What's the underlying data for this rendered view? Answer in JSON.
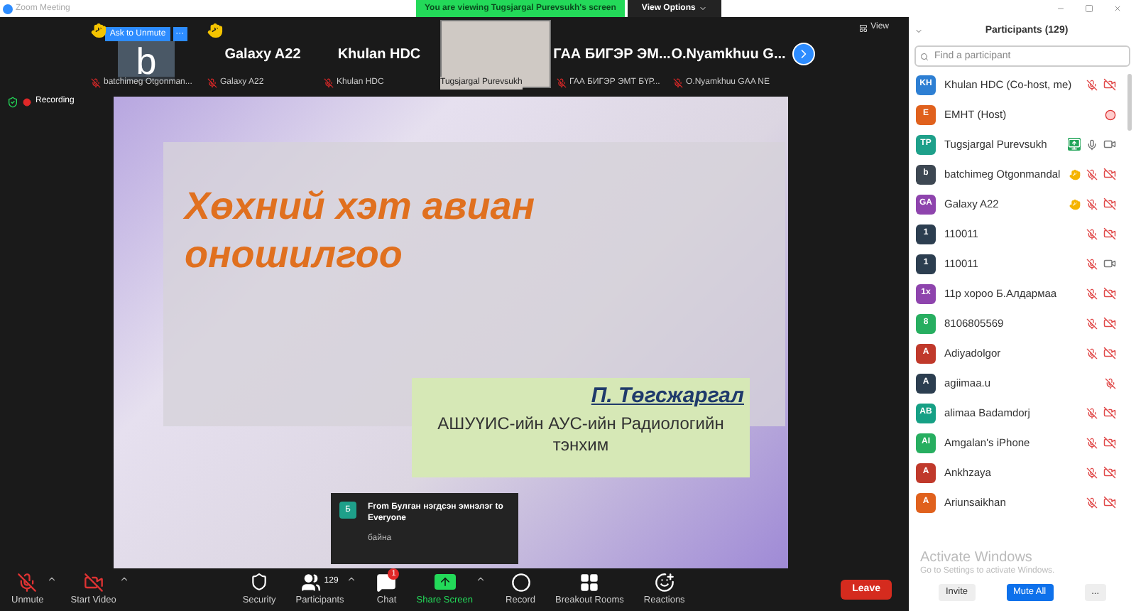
{
  "window": {
    "title": "Zoom Meeting"
  },
  "banner": {
    "text": "You are viewing Tugsjargal Purevsukh's screen",
    "options": "View Options"
  },
  "thumbnails": [
    {
      "kind": "avatar",
      "letter": "b",
      "name": "batchimeg Otgonman...",
      "hand": true,
      "ask": "Ask to Unmute",
      "more": "···"
    },
    {
      "kind": "name",
      "title": "Galaxy A22",
      "name": "Galaxy A22",
      "hand": true
    },
    {
      "kind": "name",
      "title": "Khulan HDC",
      "name": "Khulan HDC",
      "hand": false
    },
    {
      "kind": "video",
      "name": "Tugsjargal Purevsukh",
      "hand": false
    },
    {
      "kind": "name",
      "title": "ГАА БИГЭР ЭМ...",
      "name": "ГАА БИГЭР ЭМТ БҮР...",
      "hand": false
    },
    {
      "kind": "name",
      "title": "O.Nyamkhuu  G...",
      "name": "O.Nyamkhuu GAA NE",
      "hand": false
    }
  ],
  "view_button": "View",
  "recording": {
    "label": "Recording"
  },
  "slide": {
    "title": "Хөхний хэт авиан оношилгоо",
    "author": "П. Төгсжаргал",
    "affiliation": "АШУҮИС-ийн АУС-ийн Радиологийн тэнхим"
  },
  "chat_popup": {
    "avatar": "Б",
    "from": "From Булган нэгдсэн эмнэлэг to Everyone",
    "message": "байна"
  },
  "toolbar": [
    {
      "kind": "mic",
      "label": "Unmute",
      "caret": true,
      "muted": true
    },
    {
      "kind": "video",
      "label": "Start Video",
      "caret": true,
      "muted": true
    },
    {
      "kind": "security",
      "label": "Security",
      "caret": false
    },
    {
      "kind": "participants",
      "label": "Participants",
      "caret": true,
      "count": "129"
    },
    {
      "kind": "chat",
      "label": "Chat",
      "caret": false,
      "badge": "1"
    },
    {
      "kind": "share",
      "label": "Share Screen",
      "caret": true
    },
    {
      "kind": "record",
      "label": "Record",
      "caret": false
    },
    {
      "kind": "breakout",
      "label": "Breakout Rooms",
      "caret": false
    },
    {
      "kind": "reactions",
      "label": "Reactions",
      "caret": false
    }
  ],
  "leave_button": "Leave",
  "participants_panel": {
    "title": "Participants (129)",
    "search_placeholder": "Find a participant",
    "participants": [
      {
        "initials": "KH",
        "color": "#2d7fd3",
        "name": "Khulan HDC (Co-host, me)",
        "hand": false,
        "sharing": false,
        "recording": false,
        "mic": {
          "muted": true
        },
        "video": {
          "off": true
        }
      },
      {
        "initials": "E",
        "color": "#e0611d",
        "name": "EMHT (Host)",
        "hand": false,
        "sharing": false,
        "recording": true
      },
      {
        "initials": "TP",
        "color": "#1ea08a",
        "name": "Tugsjargal Purevsukh",
        "hand": false,
        "sharing": true,
        "recording": false,
        "mic": {
          "muted": false
        },
        "video": {
          "off": false
        }
      },
      {
        "initials": "b",
        "color": "#3d4752",
        "name": "batchimeg Otgonmandal",
        "hand": true,
        "sharing": false,
        "recording": false,
        "mic": {
          "muted": true
        },
        "video": {
          "off": true
        }
      },
      {
        "initials": "GA",
        "color": "#8e44ad",
        "name": "Galaxy A22",
        "hand": true,
        "sharing": false,
        "recording": false,
        "mic": {
          "muted": true
        },
        "video": {
          "off": true
        }
      },
      {
        "initials": "1",
        "color": "#2c3e50",
        "name": "110011",
        "hand": false,
        "sharing": false,
        "recording": false,
        "mic": {
          "muted": true
        },
        "video": {
          "off": true
        }
      },
      {
        "initials": "1",
        "color": "#2c3e50",
        "name": "110011",
        "hand": false,
        "sharing": false,
        "recording": false,
        "mic": {
          "muted": true
        },
        "video": {
          "off": false
        }
      },
      {
        "initials": "1х",
        "color": "#8e44ad",
        "name": "11р хороо Б.Алдармаа",
        "hand": false,
        "sharing": false,
        "recording": false,
        "mic": {
          "muted": true
        },
        "video": {
          "off": true
        }
      },
      {
        "initials": "8",
        "color": "#27ae60",
        "name": "8106805569",
        "hand": false,
        "sharing": false,
        "recording": false,
        "mic": {
          "muted": true
        },
        "video": {
          "off": true
        }
      },
      {
        "initials": "A",
        "color": "#c0392b",
        "name": "Adiyadolgor",
        "hand": false,
        "sharing": false,
        "recording": false,
        "mic": {
          "muted": true
        },
        "video": {
          "off": true
        }
      },
      {
        "initials": "A",
        "color": "#2c3e50",
        "name": "agiimaa.u",
        "hand": false,
        "sharing": false,
        "recording": false,
        "mic": {
          "muted": true
        }
      },
      {
        "initials": "AB",
        "color": "#16a085",
        "name": "alimaa Badamdorj",
        "hand": false,
        "sharing": false,
        "recording": false,
        "mic": {
          "muted": true
        },
        "video": {
          "off": true
        }
      },
      {
        "initials": "AI",
        "color": "#27ae60",
        "name": "Amgalan's iPhone",
        "hand": false,
        "sharing": false,
        "recording": false,
        "mic": {
          "muted": true
        },
        "video": {
          "off": true
        }
      },
      {
        "initials": "A",
        "color": "#c0392b",
        "name": "Ankhzaya",
        "hand": false,
        "sharing": false,
        "recording": false,
        "mic": {
          "muted": true
        },
        "video": {
          "off": true
        }
      },
      {
        "initials": "A",
        "color": "#e0611d",
        "name": "Ariunsaikhan",
        "hand": false,
        "sharing": false,
        "recording": false,
        "mic": {
          "muted": true
        },
        "video": {
          "off": true
        }
      }
    ],
    "activation": {
      "title": "Activate Windows",
      "subtitle": "Go to Settings to activate Windows."
    },
    "buttons": [
      "Invite",
      "Mute All",
      "..."
    ]
  }
}
